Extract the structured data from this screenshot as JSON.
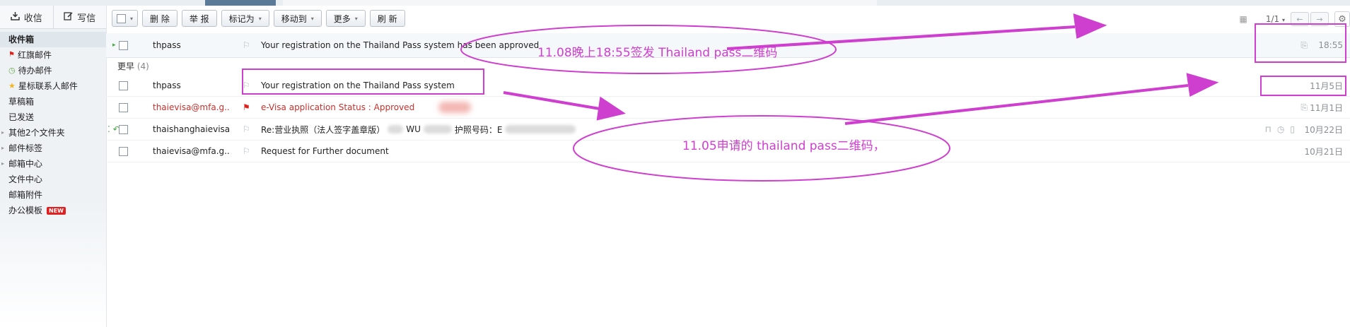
{
  "sidebar": {
    "inbox_btn": "收信",
    "compose_btn": "写信",
    "items": [
      {
        "label": "收件箱"
      },
      {
        "label": "红旗邮件"
      },
      {
        "label": "待办邮件"
      },
      {
        "label": "星标联系人邮件"
      },
      {
        "label": "草稿箱"
      },
      {
        "label": "已发送"
      },
      {
        "label": "其他2个文件夹"
      },
      {
        "label": "邮件标签"
      },
      {
        "label": "邮箱中心"
      },
      {
        "label": "文件中心"
      },
      {
        "label": "邮箱附件"
      },
      {
        "label": "办公模板",
        "badge": "NEW"
      }
    ]
  },
  "toolbar": {
    "delete": "删 除",
    "report": "举 报",
    "mark_as": "标记为",
    "move_to": "移动到",
    "more": "更多",
    "refresh": "刷 新",
    "page": "1/1"
  },
  "mails": {
    "first": {
      "sender": "thpass",
      "subject": "Your registration on the Thailand Pass system has been approved",
      "date": "18:55"
    },
    "group_label": "更早",
    "group_count": "(4)",
    "rows": [
      {
        "sender": "thpass",
        "subject": "Your registration on the Thailand Pass system",
        "date": "11月5日"
      },
      {
        "sender": "thaievisa@mfa.g...",
        "subject": "e-Visa application Status : Approved",
        "date": "11月1日"
      },
      {
        "sender": "thaishanghaievisa",
        "subject_a": "Re:营业执照（法人签字盖章版）",
        "subject_b": "WU",
        "subject_c": "护照号码：E",
        "date": "10月22日"
      },
      {
        "sender": "thaievisa@mfa.g...",
        "subject": "Request for Further document",
        "date": "10月21日"
      }
    ]
  },
  "annotations": {
    "note1": "11.08晚上18:55签发  Thailand pass二维码",
    "note2": "11.05申请的 thailand pass二维码，",
    "color": "#cf3fcf"
  }
}
